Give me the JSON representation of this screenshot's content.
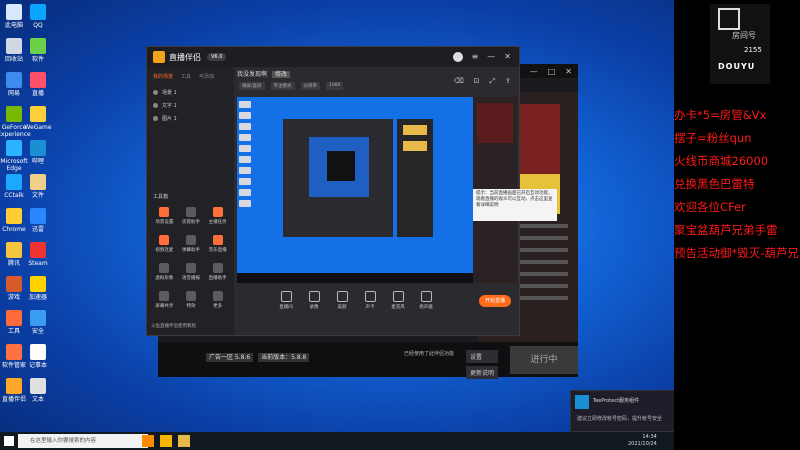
{
  "desktop": {
    "icons": [
      {
        "label": "此电脑",
        "color": "#d9e8ff"
      },
      {
        "label": "QQ",
        "color": "#0aa5ff"
      },
      {
        "label": "回收站",
        "color": "#cfd8e3"
      },
      {
        "label": "软件",
        "color": "#6bd14b"
      },
      {
        "label": "网易",
        "color": "#3c8cf0"
      },
      {
        "label": "直播",
        "color": "#ff4f6a"
      },
      {
        "label": "GeForce Experience",
        "color": "#77b900"
      },
      {
        "label": "WeGame",
        "color": "#ffcf3a"
      },
      {
        "label": "Microsoft Edge",
        "color": "#2cb3ff"
      },
      {
        "label": "哔哩",
        "color": "#1a8fd4"
      },
      {
        "label": "CCtalk",
        "color": "#1ca8ff"
      },
      {
        "label": "文件",
        "color": "#f0d089"
      },
      {
        "label": "Chrome",
        "color": "#ffcc33"
      },
      {
        "label": "迅雷",
        "color": "#2a86ff"
      },
      {
        "label": "腾讯",
        "color": "#f5c542"
      },
      {
        "label": "Steam",
        "color": "#e33"
      },
      {
        "label": "游戏",
        "color": "#d65a2a"
      },
      {
        "label": "加速器",
        "color": "#ffd200"
      },
      {
        "label": "工具",
        "color": "#ff6a3d"
      },
      {
        "label": "安全",
        "color": "#3a9df2"
      },
      {
        "label": "软件管家",
        "color": "#ff7043"
      },
      {
        "label": "记事本",
        "color": "#ffffff"
      },
      {
        "label": "直播伴侣",
        "color": "#ffa726"
      },
      {
        "label": "文本",
        "color": "#e0e0e0"
      }
    ]
  },
  "front_window": {
    "app_name": "直播伴侣",
    "version": "V6.0",
    "left_tabs": [
      "我的场景",
      "工具",
      "可添加"
    ],
    "scenes": [
      "场景 1",
      "文字 1",
      "图片 1"
    ],
    "tools_title": "工具箱",
    "tools": [
      "场景设置",
      "房管助手",
      "主播任务",
      "视频连麦",
      "弹幕助手",
      "音乐直播",
      "虚拟形象",
      "语音播报",
      "直播助手",
      "屏幕共享",
      "特效",
      "更多"
    ],
    "footer": "斗鱼直播伴侣使用教程",
    "header": {
      "title": "我没发现啊",
      "tag": "修改"
    },
    "sub_tags": [
      "横屏/竖屏",
      "专注模式",
      "分辨率",
      "1080"
    ],
    "tooltip": "提示：当前直播画面已开启互动功能，观看直播的观众可以互动，点击这里查看详细说明",
    "controls": [
      "直播间",
      "录像",
      "美颜",
      "声卡",
      "麦克风",
      "扬声器"
    ],
    "start_label": "开始直播"
  },
  "back_window": {
    "bottom_labels": [
      "广告一区 5.8.6",
      "当前版本：5.8.8"
    ],
    "hint": "已经使用了此伴侣功能",
    "side_buttons": [
      "设置",
      "更新说明"
    ],
    "go_label": "进行中"
  },
  "overlay": {
    "room_label": "房间号",
    "room_number": "2155",
    "caption": "DOUYU",
    "lines": [
      "办卡*5=房管&Vx",
      "摆子=粉丝qun",
      "火线币商城26000",
      "兑换黑色巴雷特",
      "欢迎各位CFer",
      "聚宝盆葫芦兄弟手雷",
      "预告活动御*毁灭-葫芦兄弟"
    ]
  },
  "taskbar": {
    "search_placeholder": "在这里输入你要搜索的内容",
    "time": "14:34",
    "date": "2021/10/24"
  },
  "notification": {
    "title": "TeeProtect服务组件",
    "body": "建议立即修改帐号密码，提升帐号安全"
  }
}
